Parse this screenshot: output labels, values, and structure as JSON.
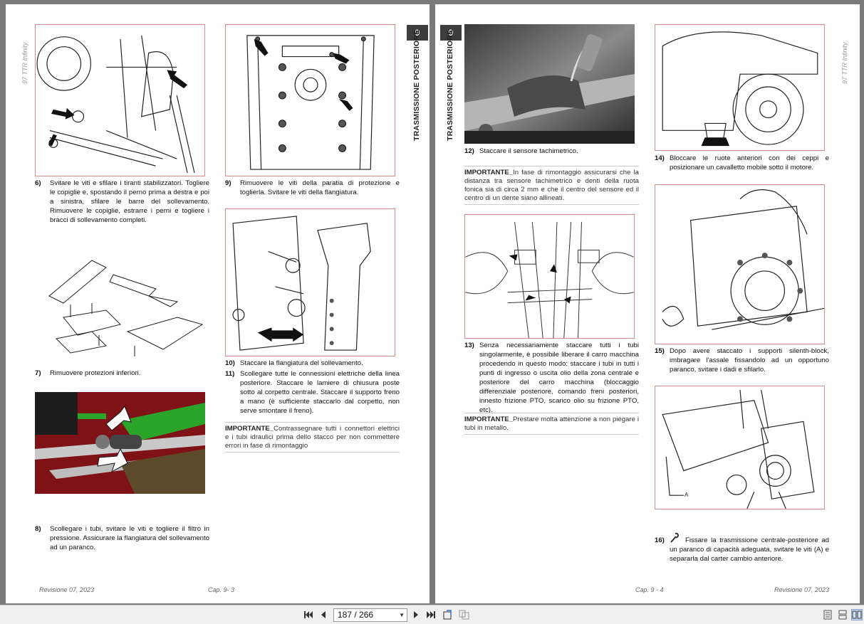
{
  "left_page": {
    "model": "97 TTR Infinity",
    "footer_revision": "Revisione 07, 2023",
    "footer_chapter": "Cap. 9- 3",
    "tab_number": "9",
    "section_title": "TRASMISSIONE POSTERIORE",
    "steps": [
      {
        "num": "6)",
        "text": "Svitare le viti e sfilare i tiranti stabilizzatori. Togliere le copiglie e, spostando il perno prima a destra e poi a sinistra, sfilare le barre del sollevamento. Rimuovere le copiglie, estrarre i perni e togliere i bracci di sollevamento completi."
      },
      {
        "num": "7)",
        "text": "Rimuovere protezioni inferiori."
      },
      {
        "num": "8)",
        "text": "Scollegare i tubi, svitare le viti e togliere il filtro in pressione. Assicurare la flangiatura del sollevamento ad un paranco."
      },
      {
        "num": "9)",
        "text": "Rimuovere le viti della paratia di protezione e toglierla. Svitare le viti della flangiatura."
      },
      {
        "num": "10)",
        "text": "Staccare la flangiatura del sollevamento."
      },
      {
        "num": "11)",
        "text": "Scollegare tutte le connessioni elettriche della linea posteriore. Staccare le lamiere di chiusura poste sotto al corpetto centrale. Staccare il supporto freno a mano (è sufficiente staccarlo  dal corpetto, non serve smontare il freno)."
      }
    ],
    "important_label": "IMPORTANTE_",
    "important_text": "Contrassegnare tutti i connettori elettrici e i tubi idraulici prima dello stacco per non commettere errori in fase di rimontaggio"
  },
  "right_page": {
    "model": "97 TTR Infinity",
    "footer_revision": "Revisione 07, 2023",
    "footer_chapter": "Cap. 9 - 4",
    "tab_number": "9",
    "section_title": "TRASMISSIONE POSTERIORE",
    "steps": [
      {
        "num": "12)",
        "text": "Staccare il sensore tachimetrico."
      },
      {
        "num": "13)",
        "text": "Senza necessariamente staccare tutti i tubi singolarmente, è possibile liberare il carro macchina procedendo in questo modo: staccare i tubi in tutti i punti di ingresso o uscita olio della zona centrale e posteriore del carro macchina (bloccaggio differenziale posteriore, comando freni posteriori, innesto frizione PTO, scarico olio su frizione PTO, etc)."
      },
      {
        "num": "14)",
        "text": "Bloccare le ruote anteriori con dei ceppi e posizionare un cavalletto mobile sotto il motore."
      },
      {
        "num": "15)",
        "text": "Dopo avere staccato i supporti silenth-block, imbragare l'assale fissandolo ad un opportuno paranco, svitare i dadi e sfilarlo."
      },
      {
        "num": "16)",
        "text": "Fissare la trasmissione centrale-posteriore ad un paranco di capacità adeguata, svitare le viti (A) e separarla dal carter cambio anteriore."
      }
    ],
    "important1_label": "IMPORTANTE_",
    "important1_text": "In fase di rimontaggio assicurarsi che la distanza tra sensore tachimetrico e denti della ruota fonica sia di circa 2 mm e che il centro del sensore ed il centro di un dente siano allineati.",
    "important2_label": "IMPORTANTE_",
    "important2_text": "Prestare molta attenzione a non piegare i tubi in metallo.",
    "fig_label_a": "A"
  },
  "toolbar": {
    "page_indicator": "187 / 266",
    "icons": [
      "first-page-icon",
      "prev-page-icon",
      "next-page-icon",
      "last-page-icon",
      "rotate-icon",
      "copy-icon",
      "single-page-view-icon",
      "continuous-view-icon",
      "two-page-view-icon"
    ]
  }
}
